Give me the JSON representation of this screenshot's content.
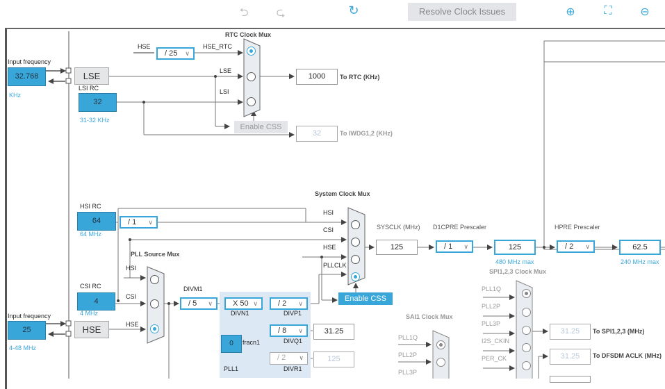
{
  "toolbar": {
    "undo_icon": "undo-icon",
    "redo_icon": "redo-icon",
    "refresh_icon": "refresh-icon",
    "resolve_label": "Resolve Clock Issues",
    "zoom_in_icon": "zoom-in-icon",
    "fit_icon": "fit-screen-icon",
    "zoom_out_icon": "zoom-out-icon"
  },
  "lse_input": {
    "label": "Input frequency",
    "value": "32.768",
    "unit": "KHz",
    "osc": "LSE"
  },
  "lsi": {
    "label": "LSI RC",
    "value": "32",
    "range": "31-32 KHz"
  },
  "rtc_mux": {
    "title": "RTC Clock Mux",
    "hse": "HSE",
    "divider": "/ 25",
    "hse_rtc": "HSE_RTC",
    "lse": "LSE",
    "lsi": "LSI",
    "output": "1000",
    "output_label": "To RTC (KHz)",
    "enable_css": "Enable CSS",
    "iwdg_value": "32",
    "iwdg_label": "To IWDG1,2 (KHz)"
  },
  "hsi": {
    "label": "HSI RC",
    "value": "64",
    "range": "64 MHz",
    "divider": "/ 1"
  },
  "sys_mux": {
    "title": "System Clock Mux",
    "inputs": [
      "HSI",
      "CSI",
      "HSE",
      "PLLCLK"
    ],
    "enable_css": "Enable CSS"
  },
  "sysclk": {
    "label": "SYSCLK (MHz)",
    "value": "125"
  },
  "d1cpre": {
    "label": "D1CPRE Prescaler",
    "value": "/ 1",
    "out": "125",
    "max": "480 MHz max"
  },
  "hpre": {
    "label": "HPRE Prescaler",
    "value": "/ 2",
    "out": "62.5",
    "max": "240 MHz max"
  },
  "pll_src": {
    "title": "PLL Source Mux",
    "inputs": [
      "HSI",
      "CSI",
      "HSE"
    ]
  },
  "csi": {
    "label": "CSI RC",
    "value": "4",
    "range": "4 MHz"
  },
  "hse_input": {
    "label": "Input frequency",
    "value": "25",
    "range": "4-48 MHz",
    "osc": "HSE"
  },
  "pll1": {
    "divm_label": "DIVM1",
    "divm": "/ 5",
    "divn": "X 50",
    "divn_label": "DIVN1",
    "divp": "/ 2",
    "divp_label": "DIVP1",
    "divq": "/ 8",
    "divq_label": "DIVQ1",
    "q_out": "31.25",
    "fracn": "0",
    "fracn_label": "fracn1",
    "name": "PLL1",
    "divr": "/ 2",
    "divr_label": "DIVR1",
    "r_out": "125"
  },
  "sai1_mux": {
    "title": "SAI1 Clock Mux",
    "inputs": [
      "PLL1Q",
      "PLL2P",
      "PLL3P"
    ]
  },
  "spi_mux": {
    "title": "SPI1,2,3 Clock Mux",
    "inputs": [
      "PLL1Q",
      "PLL2P",
      "PLL3P",
      "I2S_CKIN",
      "PER_CK"
    ],
    "spi_out": "31.25",
    "spi_label": "To SPI1,2,3 (MHz)",
    "dfsdm_out": "31.25",
    "dfsdm_label": "To DFSDM ACLK (MHz)"
  }
}
